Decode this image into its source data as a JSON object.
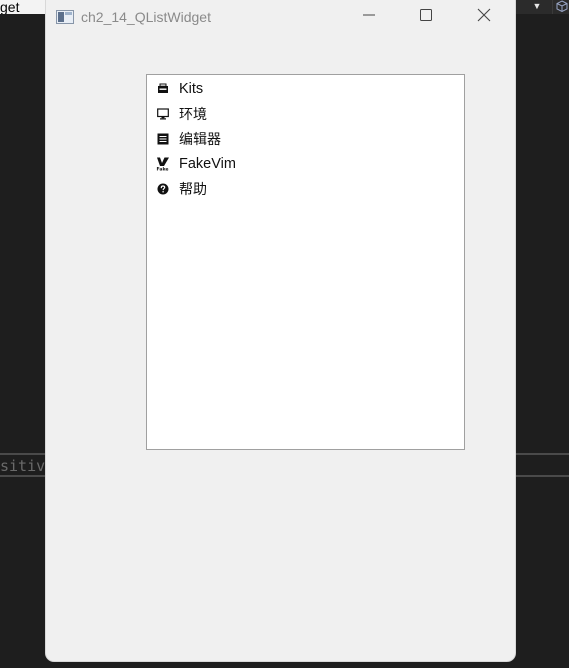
{
  "background": {
    "left_tab_text": "get",
    "code_fragment": "sitiv"
  },
  "window": {
    "title": "ch2_14_QListWidget",
    "icon": "qt-window-icon",
    "controls": {
      "minimize_icon": "minimize-icon",
      "maximize_icon": "maximize-icon",
      "close_icon": "close-icon"
    }
  },
  "list": {
    "items": [
      {
        "label": "Kits",
        "icon": "kits-icon"
      },
      {
        "label": "环境",
        "icon": "monitor-icon"
      },
      {
        "label": "编辑器",
        "icon": "editor-icon"
      },
      {
        "label": "FakeVim",
        "icon": "fakevim-icon"
      },
      {
        "label": "帮助",
        "icon": "help-icon"
      }
    ]
  }
}
